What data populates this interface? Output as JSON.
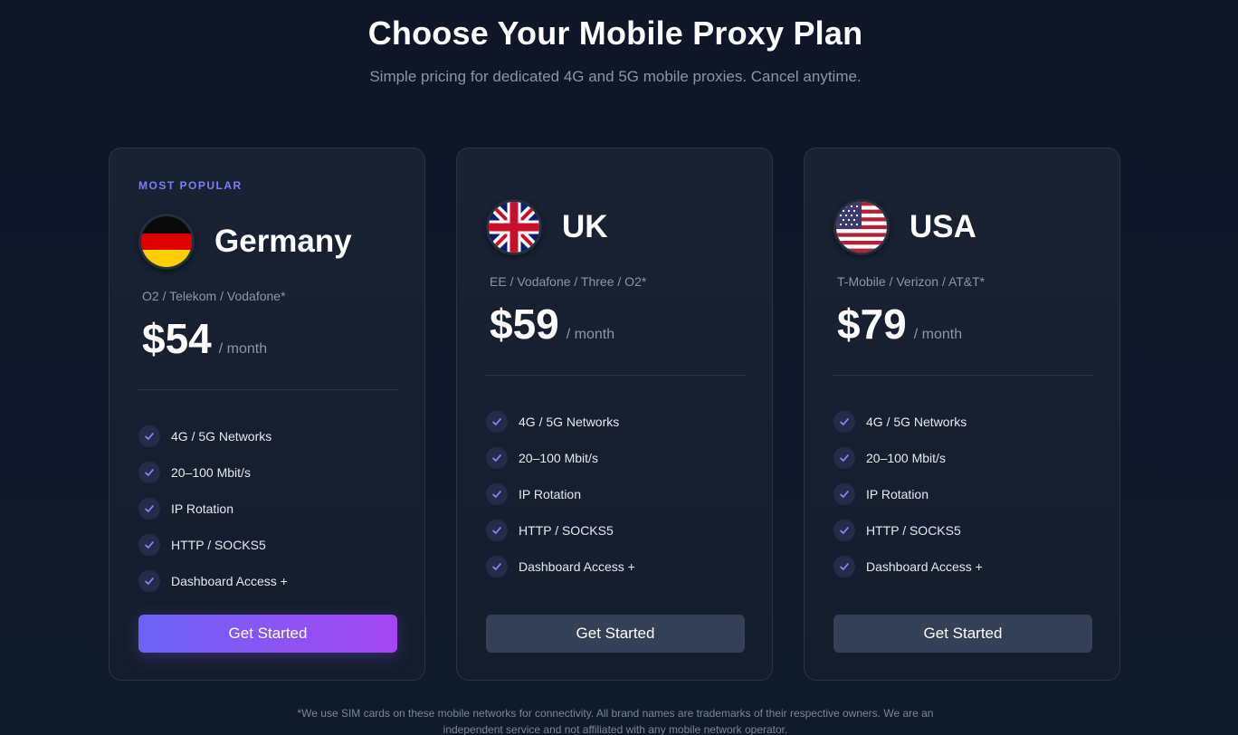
{
  "header": {
    "title": "Choose Your Mobile Proxy Plan",
    "subtitle": "Simple pricing for dedicated 4G and 5G mobile proxies. Cancel anytime."
  },
  "plans": [
    {
      "badge": "MOST POPULAR",
      "country": "Germany",
      "flag_icon": "germany-flag-icon",
      "carriers": "O2 / Telekom / Vodafone*",
      "price": "$54",
      "period": "/ month",
      "features": [
        "4G / 5G Networks",
        "20–100 Mbit/s",
        "IP Rotation",
        "HTTP / SOCKS5",
        "Dashboard Access +"
      ],
      "cta": "Get Started"
    },
    {
      "badge": "",
      "country": "UK",
      "flag_icon": "uk-flag-icon",
      "carriers": "EE / Vodafone / Three / O2*",
      "price": "$59",
      "period": "/ month",
      "features": [
        "4G / 5G Networks",
        "20–100 Mbit/s",
        "IP Rotation",
        "HTTP / SOCKS5",
        "Dashboard Access +"
      ],
      "cta": "Get Started"
    },
    {
      "badge": "",
      "country": "USA",
      "flag_icon": "usa-flag-icon",
      "carriers": "T-Mobile / Verizon / AT&T*",
      "price": "$79",
      "period": "/ month",
      "features": [
        "4G / 5G Networks",
        "20–100 Mbit/s",
        "IP Rotation",
        "HTTP / SOCKS5",
        "Dashboard Access +"
      ],
      "cta": "Get Started"
    }
  ],
  "footnote": "*We use SIM cards on these mobile networks for connectivity. All brand names are trademarks of their respective owners. We are an independent service and not affiliated with any mobile network operator.",
  "colors": {
    "background": "#0e1627",
    "card": "#182233",
    "accent": "#7c7ff5",
    "button_gradient_start": "#6b63f6",
    "button_gradient_end": "#a546f2",
    "button_secondary": "#344055"
  }
}
